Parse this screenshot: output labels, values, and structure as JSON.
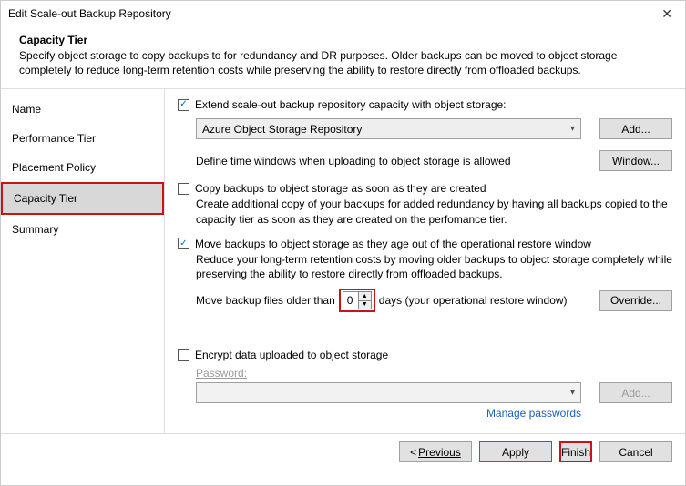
{
  "window": {
    "title": "Edit Scale-out Backup Repository"
  },
  "header": {
    "title": "Capacity Tier",
    "description": "Specify object storage to copy backups to for redundancy and DR purposes. Older backups can be moved to object storage completely to reduce long-term retention costs while preserving the ability to restore directly from offloaded backups."
  },
  "sidebar": {
    "items": [
      {
        "label": "Name"
      },
      {
        "label": "Performance Tier"
      },
      {
        "label": "Placement Policy"
      },
      {
        "label": "Capacity Tier"
      },
      {
        "label": "Summary"
      }
    ],
    "selected_index": 3
  },
  "content": {
    "extend_label": "Extend scale-out backup repository capacity with object storage:",
    "extend_checked": true,
    "repo_dropdown": "Azure Object Storage Repository",
    "add_button": "Add...",
    "time_window_text": "Define time windows when uploading to object storage is allowed",
    "window_button": "Window...",
    "copy_label": "Copy backups to object storage as soon as they are created",
    "copy_checked": false,
    "copy_desc": "Create additional copy of your backups for added redundancy by having all backups copied to the capacity tier as soon as they are created on the perfomance tier.",
    "move_label": "Move backups to object storage as they age out of the operational restore window",
    "move_checked": true,
    "move_desc": "Reduce your long-term retention costs by moving older backups to object storage completely while preserving the ability to restore directly from offloaded backups.",
    "move_prefix": "Move backup files older than",
    "move_days_value": "0",
    "move_suffix": "days (your operational restore window)",
    "override_button": "Override...",
    "encrypt_label": "Encrypt data uploaded to object storage",
    "encrypt_checked": false,
    "password_label": "Password:",
    "pw_add_button": "Add...",
    "manage_passwords": "Manage passwords"
  },
  "footer": {
    "previous": "Previous",
    "apply": "Apply",
    "finish": "Finish",
    "cancel": "Cancel"
  }
}
